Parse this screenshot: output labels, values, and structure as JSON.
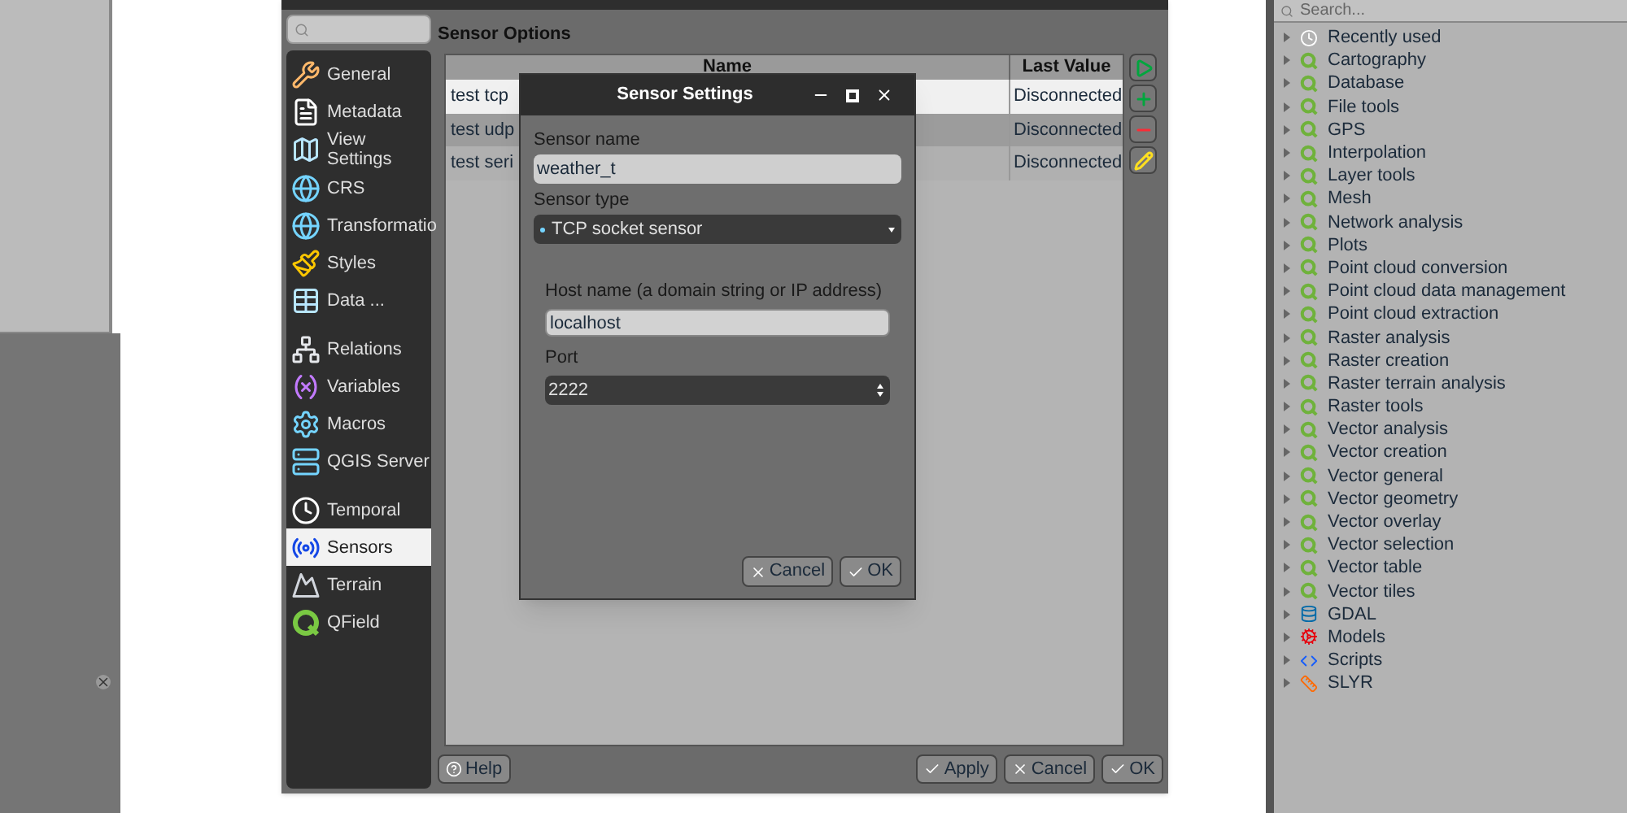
{
  "project_dialog": {
    "heading": "Sensor Options",
    "sidebar": [
      {
        "label": "General",
        "kind": "tools",
        "selected": false
      },
      {
        "label": "Metadata",
        "kind": "document",
        "selected": false
      },
      {
        "label": "View\nSettings",
        "kind": "map",
        "selected": false
      },
      {
        "label": "CRS",
        "kind": "globe",
        "selected": false
      },
      {
        "label": "Transformatio",
        "kind": "globe",
        "selected": false
      },
      {
        "label": "Styles",
        "kind": "brush",
        "selected": false
      },
      {
        "label": "Data ...",
        "kind": "table",
        "selected": false
      },
      {
        "label": "Relations",
        "kind": "relations",
        "selected": false
      },
      {
        "label": "Variables",
        "kind": "variable",
        "selected": false
      },
      {
        "label": "Macros",
        "kind": "gear",
        "selected": false
      },
      {
        "label": "QGIS Server",
        "kind": "server",
        "selected": false
      },
      {
        "label": "Temporal",
        "kind": "clock",
        "selected": false
      },
      {
        "label": "Sensors",
        "kind": "sensor",
        "selected": true
      },
      {
        "label": "Terrain",
        "kind": "terrain",
        "selected": false
      },
      {
        "label": "QField",
        "kind": "qfield",
        "selected": false
      }
    ],
    "table": {
      "columns": [
        "Name",
        "Last Value"
      ],
      "rows": [
        {
          "name": "test tcp",
          "last_value": "Disconnected",
          "selected": true
        },
        {
          "name": "test udp",
          "last_value": "Disconnected",
          "selected": false
        },
        {
          "name": "test seri",
          "last_value": "Disconnected",
          "selected": false
        }
      ]
    },
    "side_buttons": [
      {
        "kind": "play"
      },
      {
        "kind": "add"
      },
      {
        "kind": "remove"
      },
      {
        "kind": "edit"
      }
    ],
    "buttons": [
      {
        "label": "Help",
        "kind": "help"
      },
      {
        "label": "Apply",
        "kind": "check"
      },
      {
        "label": "Cancel",
        "kind": "cross"
      },
      {
        "label": "OK",
        "kind": "check"
      }
    ]
  },
  "sensor_dialog": {
    "title": "Sensor Settings",
    "sensor_name": {
      "label": "Sensor name",
      "value": "weather_t"
    },
    "sensor_type": {
      "label": "Sensor type",
      "value": "TCP socket sensor"
    },
    "host": {
      "label": "Host name (a domain string or IP address)",
      "value": "localhost"
    },
    "port": {
      "label": "Port",
      "value": "2222"
    },
    "buttons": [
      {
        "label": "Cancel",
        "kind": "cross"
      },
      {
        "label": "OK",
        "kind": "check"
      }
    ]
  },
  "processing": {
    "search": {
      "placeholder": "Search..."
    },
    "tree": [
      {
        "label": "Recently used",
        "kind": "clock",
        "expanded": false
      },
      {
        "label": "Cartography",
        "kind": "qgis",
        "expanded": false
      },
      {
        "label": "Database",
        "kind": "qgis",
        "expanded": false
      },
      {
        "label": "File tools",
        "kind": "qgis",
        "expanded": false
      },
      {
        "label": "GPS",
        "kind": "qgis",
        "expanded": false
      },
      {
        "label": "Interpolation",
        "kind": "qgis",
        "expanded": false
      },
      {
        "label": "Layer tools",
        "kind": "qgis",
        "expanded": false
      },
      {
        "label": "Mesh",
        "kind": "qgis",
        "expanded": false
      },
      {
        "label": "Network analysis",
        "kind": "qgis",
        "expanded": false
      },
      {
        "label": "Plots",
        "kind": "qgis",
        "expanded": false
      },
      {
        "label": "Point cloud conversion",
        "kind": "qgis",
        "expanded": false
      },
      {
        "label": "Point cloud data management",
        "kind": "qgis",
        "expanded": false
      },
      {
        "label": "Point cloud extraction",
        "kind": "qgis",
        "expanded": false
      },
      {
        "label": "Raster analysis",
        "kind": "qgis",
        "expanded": false
      },
      {
        "label": "Raster creation",
        "kind": "qgis",
        "expanded": false
      },
      {
        "label": "Raster terrain analysis",
        "kind": "qgis",
        "expanded": false
      },
      {
        "label": "Raster tools",
        "kind": "qgis",
        "expanded": false
      },
      {
        "label": "Vector analysis",
        "kind": "qgis",
        "expanded": false
      },
      {
        "label": "Vector creation",
        "kind": "qgis",
        "expanded": false
      },
      {
        "label": "Vector general",
        "kind": "qgis",
        "expanded": false
      },
      {
        "label": "Vector geometry",
        "kind": "qgis",
        "expanded": false
      },
      {
        "label": "Vector overlay",
        "kind": "qgis",
        "expanded": false
      },
      {
        "label": "Vector selection",
        "kind": "qgis",
        "expanded": false
      },
      {
        "label": "Vector table",
        "kind": "qgis",
        "expanded": false
      },
      {
        "label": "Vector tiles",
        "kind": "qgis",
        "expanded": false
      },
      {
        "label": "GDAL",
        "kind": "gdal",
        "expanded": false
      },
      {
        "label": "Models",
        "kind": "models",
        "expanded": false
      },
      {
        "label": "Scripts",
        "kind": "python",
        "expanded": false
      },
      {
        "label": "SLYR",
        "kind": "slyr",
        "expanded": false
      }
    ]
  }
}
